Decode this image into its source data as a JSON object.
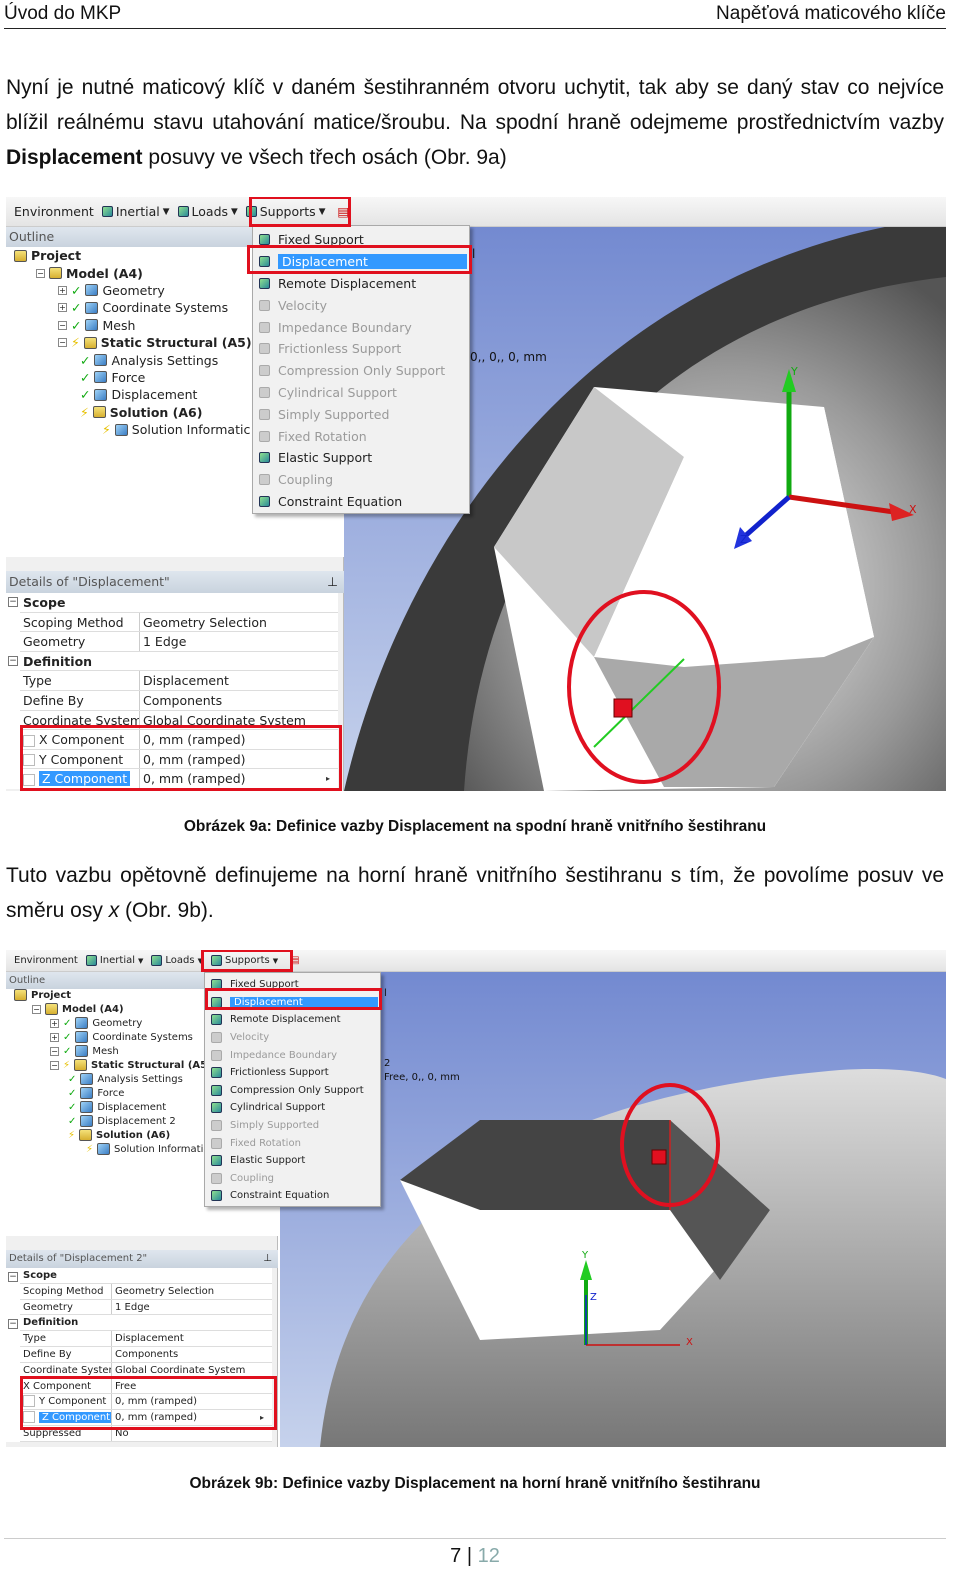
{
  "header": {
    "left": "Úvod do MKP",
    "right": "Napěťová maticového klíče"
  },
  "para1": {
    "before": "Nyní je nutné maticový klíč v daném šestihranném otvoru uchytit, tak aby se daný stav co nejvíce blížil reálnému stavu utahování matice/šroubu. Na spodní hraně odejmeme prostřednictvím vazby ",
    "bold": "Displacement",
    "after": " posuvy ve všech třech osách (Obr. 9a)"
  },
  "para2": {
    "before": "Tuto vazbu opětovně definujeme na horní hraně vnitřního šestihranu s tím, že povolíme posuv ve směru osy ",
    "italic": "x",
    "after": " (Obr. 9b)."
  },
  "figures": [
    {
      "caption": "Obrázek 9a: Definice vazby Displacement na spodní hraně vnitřního šestihranu",
      "toolbar": {
        "environment": "Environment",
        "inertial": "Inertial",
        "loads": "Loads",
        "supports": "Supports"
      },
      "outline_label": "Outline",
      "tree": [
        {
          "label": "Project",
          "level": 0,
          "bold": true
        },
        {
          "label": "Model (A4)",
          "level": 1,
          "bold": true
        },
        {
          "label": "Geometry",
          "level": 2
        },
        {
          "label": "Coordinate Systems",
          "level": 2
        },
        {
          "label": "Mesh",
          "level": 2
        },
        {
          "label": "Static Structural (A5)",
          "level": 2,
          "bold": true
        },
        {
          "label": "Analysis Settings",
          "level": 3
        },
        {
          "label": "Force",
          "level": 3
        },
        {
          "label": "Displacement",
          "level": 3
        },
        {
          "label": "Solution (A6)",
          "level": 3,
          "bold": true
        },
        {
          "label": "Solution Informatic",
          "level": 4
        }
      ],
      "menu": [
        {
          "label": "Fixed Support"
        },
        {
          "label": "Displacement",
          "selected": true
        },
        {
          "label": "Remote Displacement"
        },
        {
          "label": "Velocity",
          "disabled": true
        },
        {
          "label": "Impedance Boundary",
          "disabled": true
        },
        {
          "label": "Frictionless Support",
          "disabled": true
        },
        {
          "label": "Compression Only Support",
          "disabled": true
        },
        {
          "label": "Cylindrical Support",
          "disabled": true
        },
        {
          "label": "Simply Supported",
          "disabled": true
        },
        {
          "label": "Fixed Rotation",
          "disabled": true
        },
        {
          "label": "Elastic Support"
        },
        {
          "label": "Coupling",
          "disabled": true
        },
        {
          "label": "Constraint Equation"
        }
      ],
      "details_title": "Details of \"Displacement\"",
      "details": [
        {
          "group": "Scope"
        },
        {
          "k": "Scoping Method",
          "v": "Geometry Selection"
        },
        {
          "k": "Geometry",
          "v": "1 Edge"
        },
        {
          "group": "Definition"
        },
        {
          "k": "Type",
          "v": "Displacement"
        },
        {
          "k": "Define By",
          "v": "Components"
        },
        {
          "k": "Coordinate System",
          "v": "Global Coordinate System"
        },
        {
          "k": "X Component",
          "v": "0, mm  (ramped)",
          "cb": true
        },
        {
          "k": "Y Component",
          "v": "0, mm  (ramped)",
          "cb": true
        },
        {
          "k": "Z Component",
          "v": "0, mm  (ramped)",
          "cb": true,
          "hl": true
        }
      ],
      "viewport_text": [
        "l",
        "0,, 0,, 0, mm"
      ],
      "axes": {
        "x": "X",
        "y": "Y",
        "z": "Z"
      }
    },
    {
      "caption": "Obrázek 9b: Definice vazby Displacement na horní hraně vnitřního šestihranu",
      "toolbar": {
        "environment": "Environment",
        "inertial": "Inertial",
        "loads": "Loads",
        "supports": "Supports"
      },
      "outline_label": "Outline",
      "tree": [
        {
          "label": "Project",
          "level": 0,
          "bold": true
        },
        {
          "label": "Model (A4)",
          "level": 1,
          "bold": true
        },
        {
          "label": "Geometry",
          "level": 2
        },
        {
          "label": "Coordinate Systems",
          "level": 2
        },
        {
          "label": "Mesh",
          "level": 2
        },
        {
          "label": "Static Structural (A5)",
          "level": 2,
          "bold": true
        },
        {
          "label": "Analysis Settings",
          "level": 3
        },
        {
          "label": "Force",
          "level": 3
        },
        {
          "label": "Displacement",
          "level": 3
        },
        {
          "label": "Displacement 2",
          "level": 3
        },
        {
          "label": "Solution (A6)",
          "level": 3,
          "bold": true
        },
        {
          "label": "Solution Informatic",
          "level": 4
        }
      ],
      "menu": [
        {
          "label": "Fixed Support"
        },
        {
          "label": "Displacement",
          "selected": true
        },
        {
          "label": "Remote Displacement"
        },
        {
          "label": "Velocity",
          "disabled": true
        },
        {
          "label": "Impedance Boundary",
          "disabled": true
        },
        {
          "label": "Frictionless Support"
        },
        {
          "label": "Compression Only Support"
        },
        {
          "label": "Cylindrical Support"
        },
        {
          "label": "Simply Supported",
          "disabled": true
        },
        {
          "label": "Fixed Rotation",
          "disabled": true
        },
        {
          "label": "Elastic Support"
        },
        {
          "label": "Coupling",
          "disabled": true
        },
        {
          "label": "Constraint Equation"
        }
      ],
      "details_title": "Details of \"Displacement 2\"",
      "details": [
        {
          "group": "Scope"
        },
        {
          "k": "Scoping Method",
          "v": "Geometry Selection"
        },
        {
          "k": "Geometry",
          "v": "1 Edge"
        },
        {
          "group": "Definition"
        },
        {
          "k": "Type",
          "v": "Displacement"
        },
        {
          "k": "Define By",
          "v": "Components"
        },
        {
          "k": "Coordinate System",
          "v": "Global Coordinate System"
        },
        {
          "k": "X Component",
          "v": "Free"
        },
        {
          "k": "Y Component",
          "v": "0, mm  (ramped)",
          "cb": true
        },
        {
          "k": "Z Component",
          "v": "0, mm  (ramped)",
          "cb": true,
          "hl": true
        },
        {
          "k": "Suppressed",
          "v": "No"
        }
      ],
      "viewport_text": [
        "l",
        "2",
        "Free, 0,, 0, mm"
      ],
      "axes": {
        "x": "X",
        "y": "Y",
        "z": "Z"
      }
    }
  ],
  "footer": {
    "page": "7",
    "separator": "|",
    "total": "12"
  }
}
